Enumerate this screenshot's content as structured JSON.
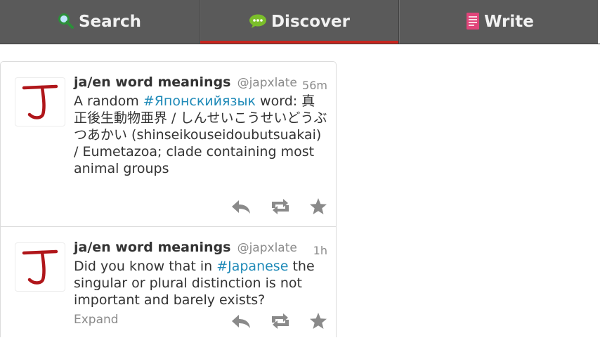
{
  "tabs": [
    {
      "label": "Search",
      "icon": "magnifier-icon",
      "active": false
    },
    {
      "label": "Discover",
      "icon": "speech-bubble-icon",
      "active": true
    },
    {
      "label": "Write",
      "icon": "notepad-icon",
      "active": false
    }
  ],
  "colors": {
    "tabbar": "#5a5a5a",
    "active_indicator": "#c8261f",
    "hashtag": "#1f8ab8",
    "avatar_letter": "#b0161a"
  },
  "tweets": [
    {
      "name": "ja/en word meanings",
      "handle": "@japxlate",
      "time": "56m",
      "avatar_letter": "J",
      "text_pre": "A random ",
      "hashtag": "#Японскийязык",
      "text_post": " word: 真正後生動物亜界 / しんせいこうせいどうぶつあかい (shinseikouseidoubutsuakai) / Eumetazoa; clade containing most animal groups"
    },
    {
      "name": "ja/en word meanings",
      "handle": "@japxlate",
      "time": "1h",
      "avatar_letter": "J",
      "text_pre": "Did you know that in ",
      "hashtag": "#Japanese",
      "text_post": " the singular or plural distinction is not important and barely exists?",
      "expand_label": "Expand"
    }
  ]
}
